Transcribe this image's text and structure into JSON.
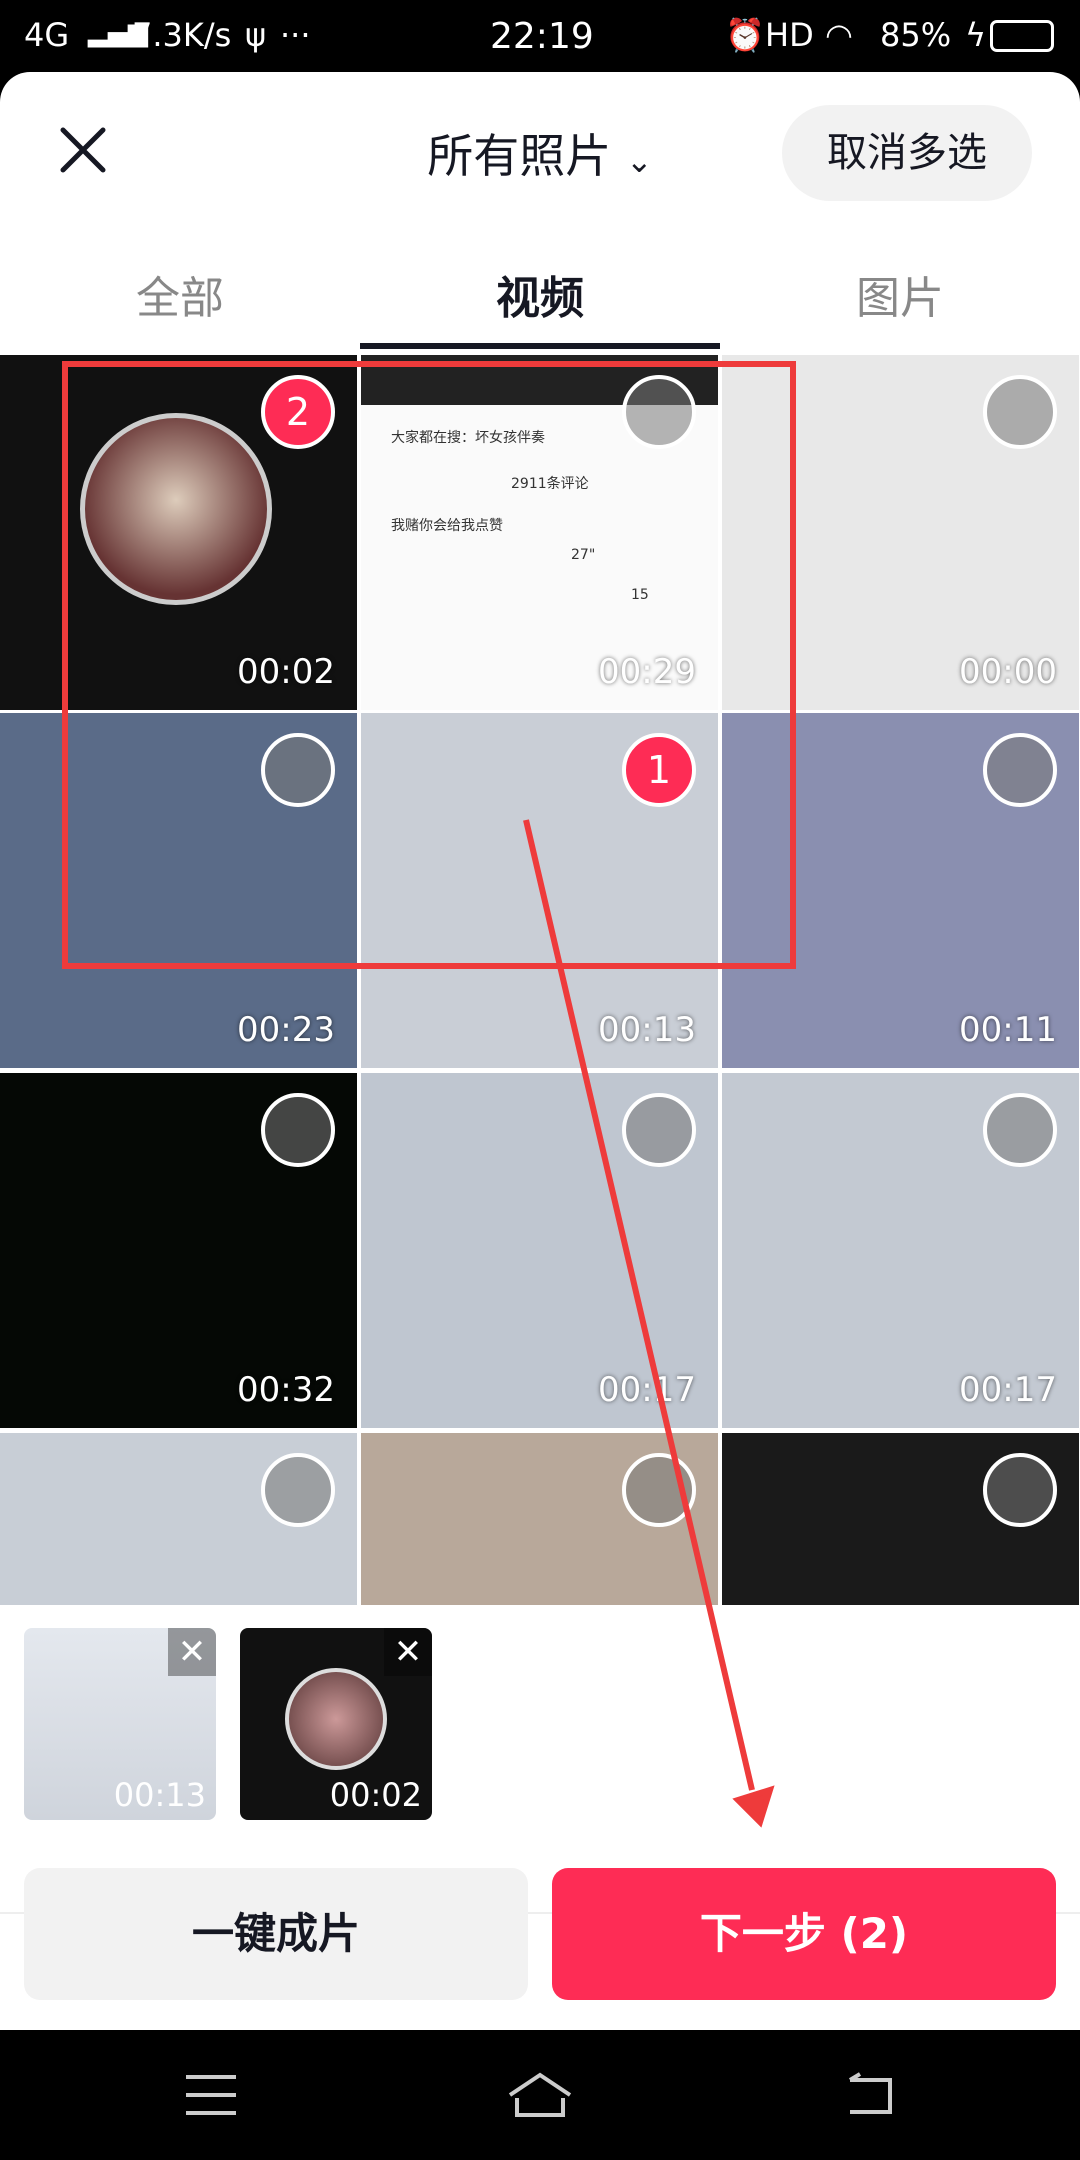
{
  "status_bar": {
    "network": "4G",
    "speed": "7.3K/s",
    "more": "···",
    "time": "22:19",
    "hd": "HD",
    "battery": "85%"
  },
  "header": {
    "title": "所有照片",
    "cancel_multi": "取消多选"
  },
  "tabs": [
    {
      "label": "全部"
    },
    {
      "label": "视频",
      "active": true
    },
    {
      "label": "图片"
    }
  ],
  "grid": [
    {
      "duration": "00:02",
      "selected": "2",
      "bg": "#111"
    },
    {
      "duration": "00:29",
      "selected": "",
      "bg": "#fafafa",
      "text": [
        "大家都在搜：坏女孩伴奏",
        "2911条评论",
        "我赌你会给我点赞",
        "27\"",
        "15"
      ]
    },
    {
      "duration": "00:00",
      "selected": "",
      "bg": "#e8e8e8"
    },
    {
      "duration": "00:23",
      "selected": "",
      "bg": "#5a6b88"
    },
    {
      "duration": "00:13",
      "selected": "1",
      "bg": "#c9ced6"
    },
    {
      "duration": "00:11",
      "selected": "",
      "bg": "#8a8fb0"
    },
    {
      "duration": "00:32",
      "selected": "",
      "bg": "#050805"
    },
    {
      "duration": "00:17",
      "selected": "",
      "bg": "#bfc6d0"
    },
    {
      "duration": "00:17",
      "selected": "",
      "bg": "#c3c9d2"
    },
    {
      "duration": "",
      "selected": "",
      "bg": "#c8ced6"
    },
    {
      "duration": "",
      "selected": "",
      "bg": "#b8a89a"
    },
    {
      "duration": "",
      "selected": "",
      "bg": "#1a1a1a"
    }
  ],
  "selected_strip": [
    {
      "duration": "00:13",
      "bg": "#d3d8df"
    },
    {
      "duration": "00:02",
      "bg": "#111"
    }
  ],
  "buttons": {
    "one_click": "一键成片",
    "next": "下一步 (2)"
  },
  "colors": {
    "accent": "#fe2c55",
    "annotation": "#ee3b3b"
  }
}
